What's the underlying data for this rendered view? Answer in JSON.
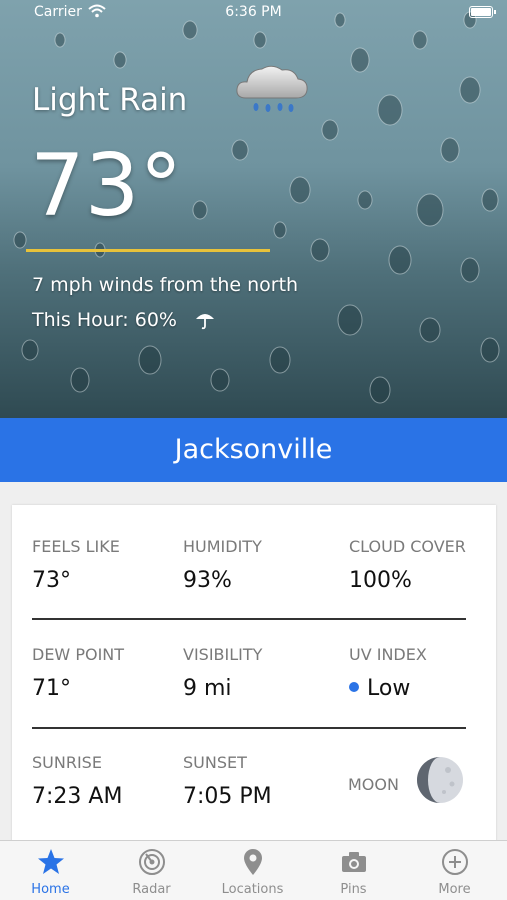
{
  "status_bar": {
    "carrier": "Carrier",
    "time": "6:36 PM"
  },
  "current": {
    "condition": "Light Rain",
    "temperature": "73°",
    "wind": "7 mph winds from the north",
    "this_hour": "This Hour: 60%"
  },
  "location": {
    "city": "Jacksonville"
  },
  "details": {
    "feels_like": {
      "label": "FEELS LIKE",
      "value": "73°"
    },
    "humidity": {
      "label": "HUMIDITY",
      "value": "93%"
    },
    "cloud_cover": {
      "label": "CLOUD COVER",
      "value": "100%"
    },
    "dew_point": {
      "label": "DEW POINT",
      "value": "71°"
    },
    "visibility": {
      "label": "VISIBILITY",
      "value": "9 mi"
    },
    "uv_index": {
      "label": "UV INDEX",
      "value": "Low"
    },
    "sunrise": {
      "label": "SUNRISE",
      "value": "7:23 AM"
    },
    "sunset": {
      "label": "SUNSET",
      "value": "7:05 PM"
    },
    "moon": {
      "label": "MOON"
    }
  },
  "tabs": [
    {
      "label": "Home",
      "icon": "star-icon",
      "active": true
    },
    {
      "label": "Radar",
      "icon": "radar-icon",
      "active": false
    },
    {
      "label": "Locations",
      "icon": "location-pin-icon",
      "active": false
    },
    {
      "label": "Pins",
      "icon": "camera-icon",
      "active": false
    },
    {
      "label": "More",
      "icon": "plus-circle-icon",
      "active": false
    }
  ],
  "colors": {
    "accent": "#2a73e6",
    "underline": "#e8c23a",
    "uv_low": "#2a73e6"
  }
}
